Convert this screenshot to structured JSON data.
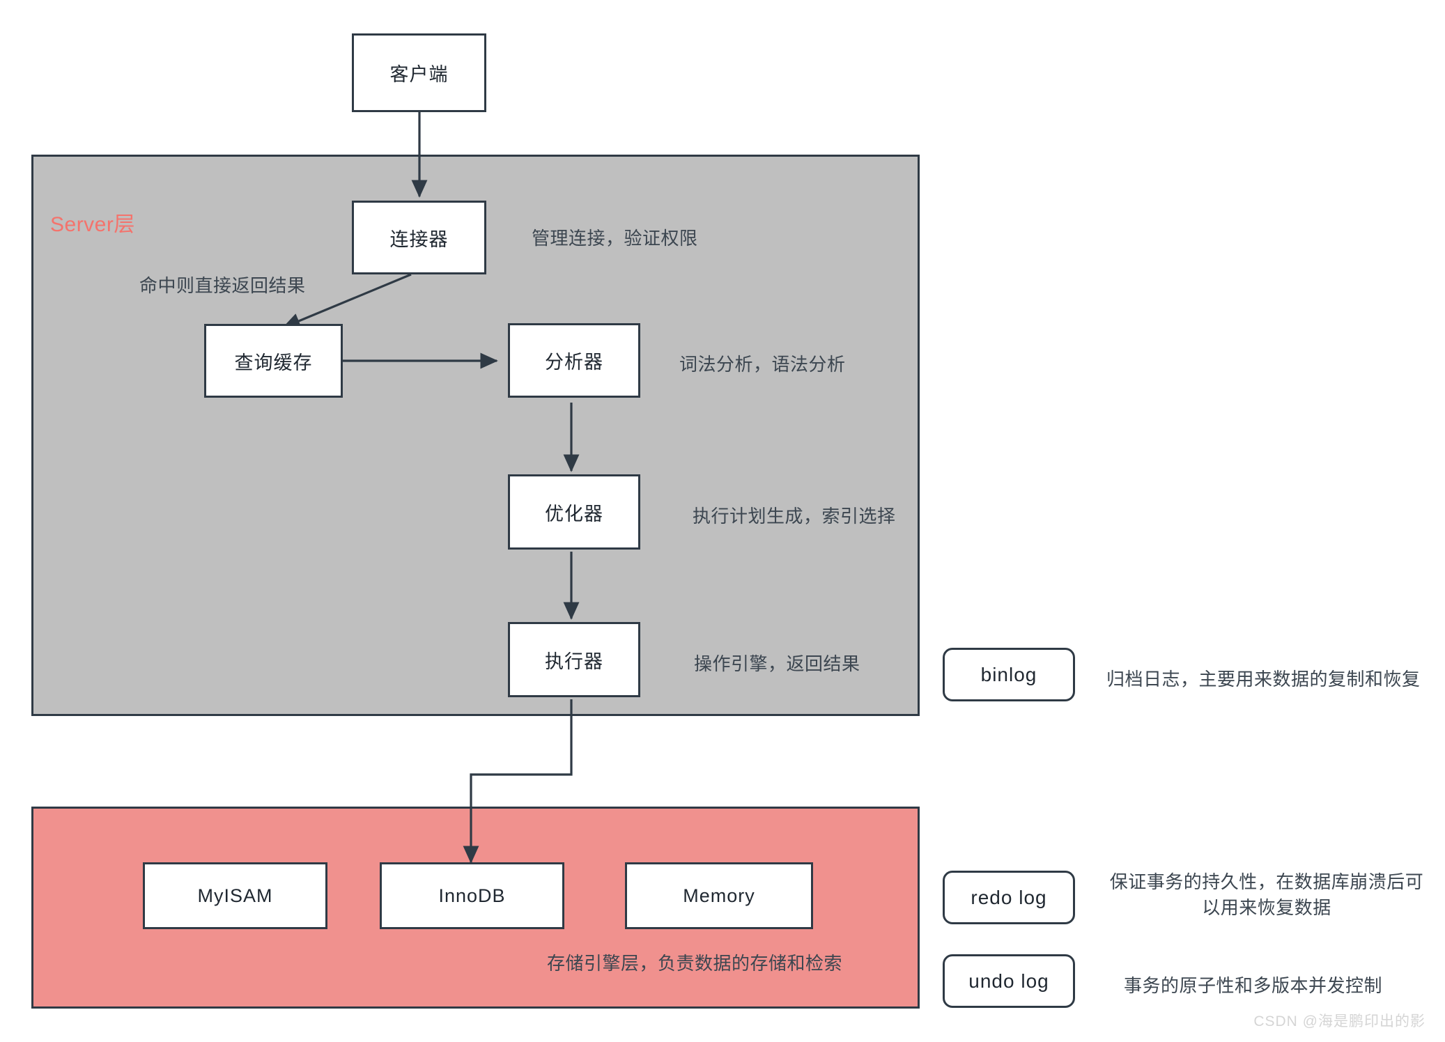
{
  "diagram": {
    "title_watermark": "CSDN @海是鹏印出的影",
    "layers": [
      {
        "id": "server",
        "title": "Server层",
        "title_color": "#f4736c",
        "fill": "#bfbfbf"
      },
      {
        "id": "engine",
        "title": "",
        "caption": "存储引擎层，负责数据的存储和检索",
        "fill": "#f0918e"
      }
    ],
    "nodes": {
      "client": "客户端",
      "connector": "连接器",
      "query_cache": "查询缓存",
      "analyzer": "分析器",
      "optimizer": "优化器",
      "executor": "执行器",
      "myisam": "MyISAM",
      "innodb": "InnoDB",
      "memory": "Memory",
      "binlog": "binlog",
      "redolog": "redo log",
      "undolog": "undo log"
    },
    "annotations": {
      "connector": "管理连接，验证权限",
      "cache_hit": "命中则直接返回结果",
      "analyzer": "词法分析，语法分析",
      "optimizer": "执行计划生成，索引选择",
      "executor": "操作引擎，返回结果",
      "engine_caption": "存储引擎层，负责数据的存储和检索",
      "binlog": "归档日志，主要用来数据的复制和恢复",
      "redolog": "保证事务的持久性，在数据库崩溃后可以用来恢复数据",
      "undolog": "事务的原子性和多版本并发控制"
    },
    "colors": {
      "stroke": "#2f3a45",
      "server_layer": "#bfbfbf",
      "engine_layer": "#f0918e",
      "accent_red": "#f4736c",
      "text": "#3c4650",
      "watermark": "#d5d5d5"
    }
  }
}
